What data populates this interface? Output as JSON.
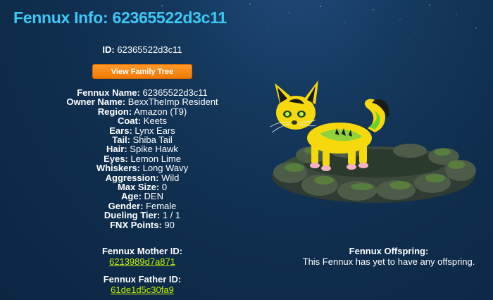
{
  "header": {
    "title": "Fennux Info: 62365522d3c11"
  },
  "id_line": {
    "label": "ID:",
    "value": "62365522d3c11"
  },
  "family_tree_button": "View Family Tree",
  "fields": [
    {
      "label": "Fennux Name:",
      "value": "62365522d3c11"
    },
    {
      "label": "Owner Name:",
      "value": "BexxTheImp Resident"
    },
    {
      "label": "Region:",
      "value": "Amazon (T9)"
    },
    {
      "label": "Coat:",
      "value": "Keets"
    },
    {
      "label": "Ears:",
      "value": "Lynx Ears"
    },
    {
      "label": "Tail:",
      "value": "Shiba Tail"
    },
    {
      "label": "Hair:",
      "value": "Spike Hawk"
    },
    {
      "label": "Eyes:",
      "value": "Lemon Lime"
    },
    {
      "label": "Whiskers:",
      "value": "Long Wavy"
    },
    {
      "label": "Aggression:",
      "value": "Wild"
    },
    {
      "label": "Max Size:",
      "value": "0"
    },
    {
      "label": "Age:",
      "value": "DEN"
    },
    {
      "label": "Gender:",
      "value": "Female"
    },
    {
      "label": "Dueling Tier:",
      "value": "1 / 1"
    },
    {
      "label": "FNX Points:",
      "value": "90"
    }
  ],
  "mother": {
    "label": "Fennux Mother ID:",
    "id": "6213989d7a871"
  },
  "father": {
    "label": "Fennux Father ID:",
    "id": "61de1d5c30fa9"
  },
  "offspring": {
    "label": "Fennux Offspring:",
    "text": "This Fennux has yet to have any offspring."
  },
  "colors": {
    "title": "#3dc8f4",
    "link": "#c4f000",
    "button": "#f58a12",
    "background": "#12375d"
  },
  "pet_image": {
    "icon": "yellow-fox-on-mossy-stones"
  }
}
